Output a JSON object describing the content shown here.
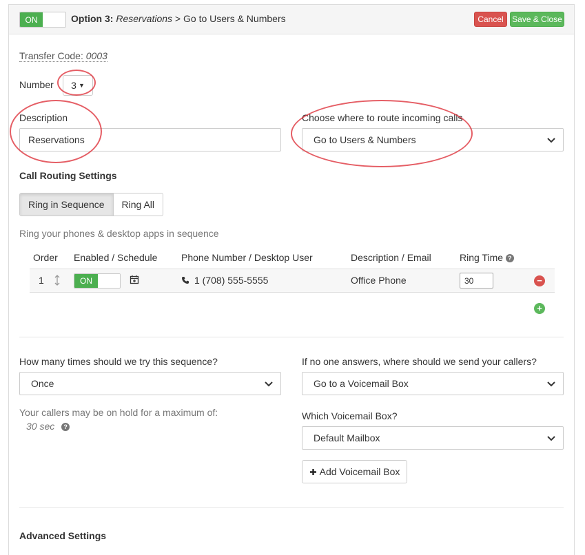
{
  "header": {
    "toggle_label": "ON",
    "crumb_prefix": "Option 3:",
    "crumb_name": "Reservations",
    "crumb_sep": ">",
    "crumb_dest": "Go to Users & Numbers",
    "cancel_label": "Cancel",
    "save_label": "Save & Close"
  },
  "transfer": {
    "label": "Transfer Code:",
    "code": "0003"
  },
  "number": {
    "label": "Number",
    "value": "3"
  },
  "description": {
    "label": "Description",
    "value": "Reservations"
  },
  "route": {
    "label": "Choose where to route incoming calls",
    "value": "Go to Users & Numbers"
  },
  "call_routing": {
    "title": "Call Routing Settings",
    "modes": [
      "Ring in Sequence",
      "Ring All"
    ],
    "hint": "Ring your phones & desktop apps in sequence",
    "columns": [
      "Order",
      "Enabled / Schedule",
      "Phone Number / Desktop User",
      "Description / Email",
      "Ring Time"
    ],
    "rows": [
      {
        "order": "1",
        "enabled": "ON",
        "phone": "1 (708) 555-5555",
        "description": "Office Phone",
        "ring_time": "30"
      }
    ]
  },
  "sequence": {
    "tries_label": "How many times should we try this sequence?",
    "tries_value": "Once",
    "hold_label": "Your callers may be on hold for a maximum of:",
    "hold_value": "30 sec"
  },
  "no_answer": {
    "label": "If no one answers, where should we send your callers?",
    "value": "Go to a Voicemail Box",
    "voicemail_label": "Which Voicemail Box?",
    "voicemail_value": "Default Mailbox",
    "add_voicemail": "Add Voicemail Box"
  },
  "advanced": {
    "title": "Advanced Settings"
  },
  "colors": {
    "on_green": "#4caf50",
    "cancel_red": "#d9534f",
    "save_green": "#5cb85c",
    "annotation_red": "#dc2832"
  }
}
